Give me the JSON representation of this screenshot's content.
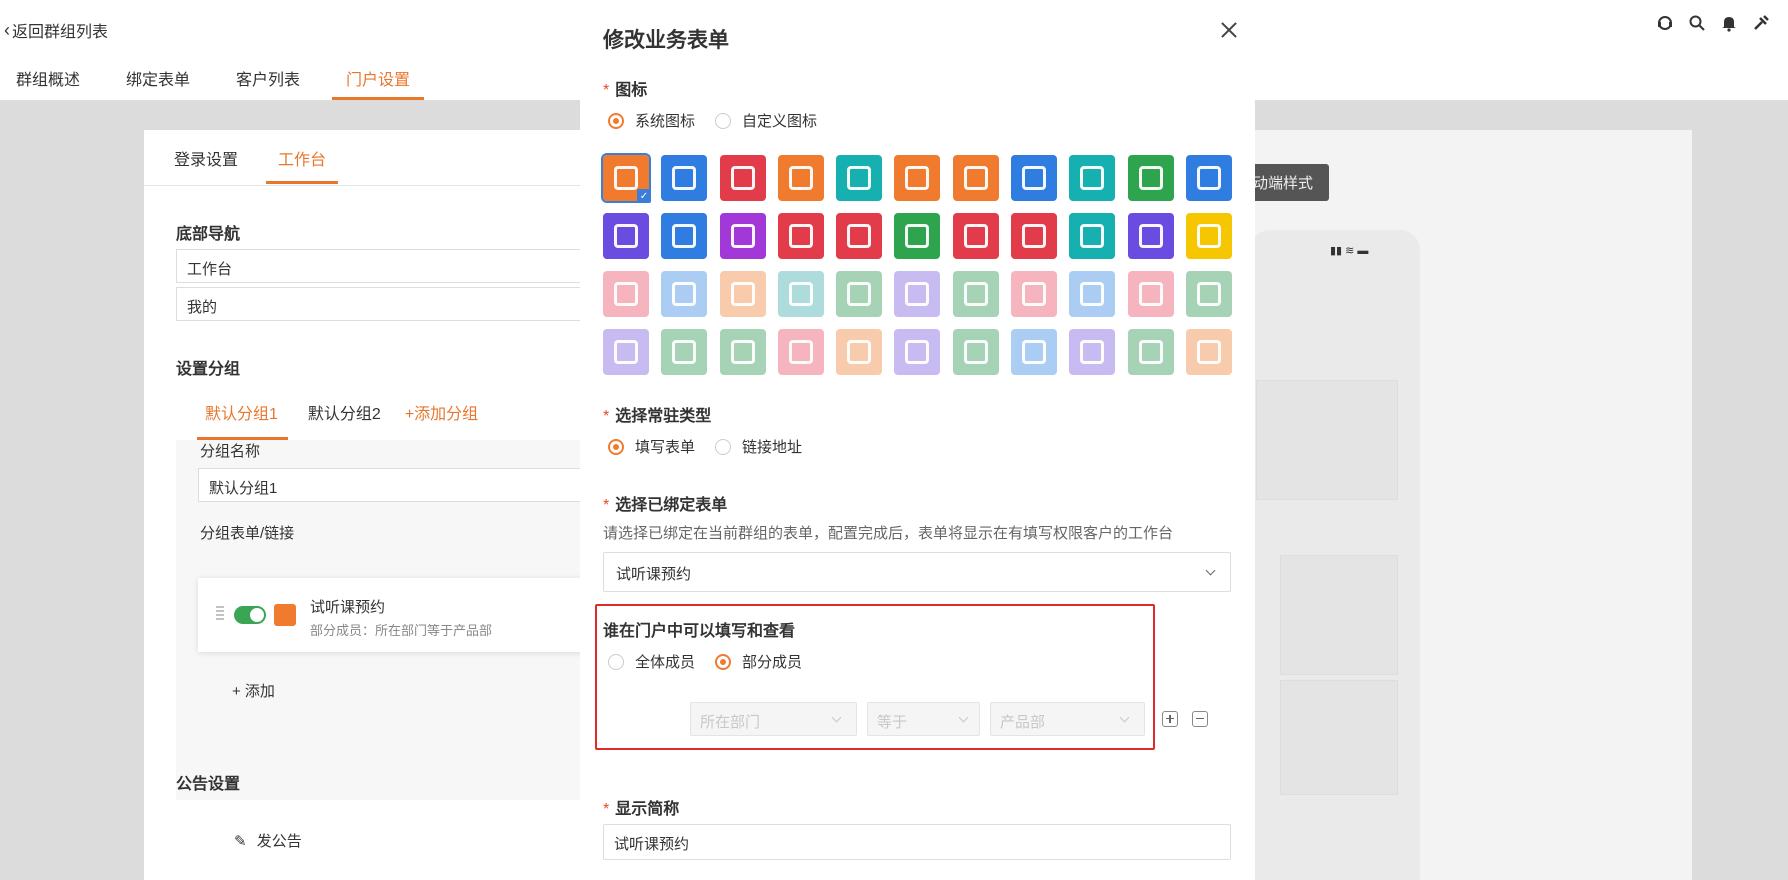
{
  "nav": {
    "back_label": "返回群组列表",
    "tabs": [
      {
        "label": "群组概述"
      },
      {
        "label": "绑定表单"
      },
      {
        "label": "客户列表"
      },
      {
        "label": "门户设置"
      }
    ],
    "active_tab": "门户设置",
    "icons": [
      "support-icon",
      "search-icon",
      "bell-icon",
      "tools-icon"
    ]
  },
  "portal": {
    "tabs": [
      {
        "label": "登录设置"
      },
      {
        "label": "工作台"
      }
    ],
    "active_tab": "工作台",
    "bottom_nav_title": "底部导航",
    "bottom_nav_items": [
      "工作台",
      "我的"
    ],
    "group_settings_title": "设置分组",
    "group_tabs": [
      "默认分组1",
      "默认分组2"
    ],
    "add_group_label": "+添加分组",
    "group_name_label": "分组名称",
    "group_name_value": "默认分组1",
    "group_forms_label": "分组表单/链接",
    "form_item": {
      "title": "试听课预约",
      "subtitle": "部分成员：所在部门等于产品部",
      "enabled": true
    },
    "add_label": "+ 添加",
    "notice_title": "公告设置",
    "post_notice_label": "发公告",
    "style_button": "动端样式"
  },
  "modal": {
    "title": "修改业务表单",
    "icon_field": {
      "label": "图标",
      "options": [
        "系统图标",
        "自定义图标"
      ],
      "selected": "系统图标"
    },
    "icons": [
      {
        "name": "dining-icon",
        "color": "#f07b2e"
      },
      {
        "name": "factory-icon",
        "color": "#2f7de1"
      },
      {
        "name": "heart-icon",
        "color": "#e23c4b"
      },
      {
        "name": "document-icon",
        "color": "#f07b2e"
      },
      {
        "name": "drink-icon",
        "color": "#16b0b0"
      },
      {
        "name": "cart-icon",
        "color": "#f07b2e"
      },
      {
        "name": "bowl-icon",
        "color": "#f07b2e"
      },
      {
        "name": "ship-icon",
        "color": "#2f7de1"
      },
      {
        "name": "plane-icon",
        "color": "#16b0b0"
      },
      {
        "name": "book-icon",
        "color": "#2ea44f"
      },
      {
        "name": "dollar-icon",
        "color": "#2f7de1"
      },
      {
        "name": "truck-icon",
        "color": "#6b4ce0"
      },
      {
        "name": "taxi-icon",
        "color": "#2f7de1"
      },
      {
        "name": "camera-icon",
        "color": "#a238d8"
      },
      {
        "name": "dress-icon",
        "color": "#e23c4b"
      },
      {
        "name": "cake-icon",
        "color": "#e23c4b"
      },
      {
        "name": "person-icon",
        "color": "#2ea44f"
      },
      {
        "name": "handshake-icon",
        "color": "#e23c4b"
      },
      {
        "name": "graduation-icon",
        "color": "#e23c4b"
      },
      {
        "name": "medkit-icon",
        "color": "#16b0b0"
      },
      {
        "name": "bicycle-icon",
        "color": "#6b4ce0"
      },
      {
        "name": "tshirt-icon",
        "color": "#f6c700"
      },
      {
        "name": "hand-icon",
        "color": "#f07a8a"
      },
      {
        "name": "chart-icon",
        "color": "#6aa6ea"
      },
      {
        "name": "team-icon",
        "color": "#f3a26a"
      },
      {
        "name": "presentation-icon",
        "color": "#6cc0c0"
      },
      {
        "name": "calculator-icon",
        "color": "#5fb07a"
      },
      {
        "name": "computer-icon",
        "color": "#9a84e8"
      },
      {
        "name": "bottles-icon",
        "color": "#5fb07a"
      },
      {
        "name": "printer-icon",
        "color": "#f07a8a"
      },
      {
        "name": "medal-icon",
        "color": "#6aa6ea"
      },
      {
        "name": "laurel-icon",
        "color": "#f07a8a"
      },
      {
        "name": "cup-icon",
        "color": "#5fb07a"
      },
      {
        "name": "location-icon",
        "color": "#9a84e8"
      },
      {
        "name": "folder-icon",
        "color": "#5fb07a"
      },
      {
        "name": "building-icon",
        "color": "#5fb07a"
      },
      {
        "name": "gift-icon",
        "color": "#f07a8a"
      },
      {
        "name": "chat-icon",
        "color": "#f3a26a"
      },
      {
        "name": "broadcast-icon",
        "color": "#9a84e8"
      },
      {
        "name": "network-icon",
        "color": "#5fb07a"
      },
      {
        "name": "gamepad-icon",
        "color": "#6aa6ea"
      },
      {
        "name": "lock-icon",
        "color": "#9a84e8"
      },
      {
        "name": "tree-icon",
        "color": "#5fb07a"
      },
      {
        "name": "toggle-icon",
        "color": "#f3a26a"
      }
    ],
    "selected_icon": "dining-icon",
    "type_field": {
      "label": "选择常驻类型",
      "options": [
        "填写表单",
        "链接地址"
      ],
      "selected": "填写表单"
    },
    "form_field": {
      "label": "选择已绑定表单",
      "hint": "请选择已绑定在当前群组的表单，配置完成后，表单将显示在有填写权限客户的工作台",
      "value": "试听课预约"
    },
    "visibility": {
      "label": "谁在门户中可以填写和查看",
      "options": [
        "全体成员",
        "部分成员"
      ],
      "selected": "部分成员",
      "condition": {
        "field": "所在部门",
        "operator": "等于",
        "value": "产品部"
      }
    },
    "short_name": {
      "label": "显示简称",
      "value": "试听课预约"
    }
  }
}
